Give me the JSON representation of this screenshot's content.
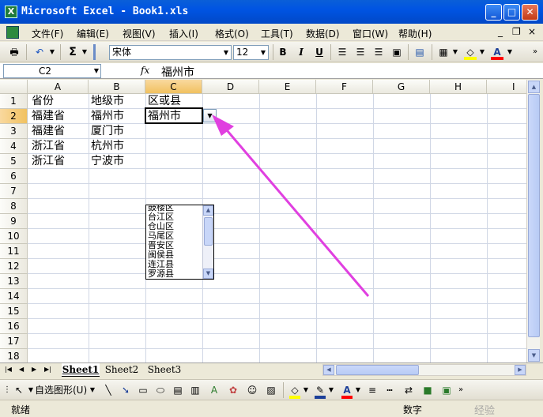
{
  "window": {
    "title": "Microsoft Excel - Book1.xls",
    "minimize": "_",
    "maximize": "□",
    "close": "✕"
  },
  "menu": {
    "items": [
      "文件(F)",
      "编辑(E)",
      "视图(V)",
      "插入(I)",
      "格式(O)",
      "工具(T)",
      "数据(D)",
      "窗口(W)",
      "帮助(H)"
    ],
    "doc_minimize": "_",
    "doc_restore": "❐",
    "doc_close": "×"
  },
  "toolbar": {
    "font_name": "宋体",
    "font_size": "12",
    "bold": "B",
    "italic": "I",
    "underline": "U",
    "sum": "Σ",
    "fill_color": "#ffff00",
    "font_color": "#ff0000"
  },
  "formula_bar": {
    "name_box": "C2",
    "fx": "fx",
    "value": "福州市"
  },
  "columns": [
    "A",
    "B",
    "C",
    "D",
    "E",
    "F",
    "G",
    "H",
    "I"
  ],
  "selected_column": "C",
  "rows": [
    "1",
    "2",
    "3",
    "4",
    "5",
    "6",
    "7",
    "8",
    "9",
    "10",
    "11",
    "12",
    "13",
    "14",
    "15",
    "16",
    "17",
    "18"
  ],
  "selected_row": "2",
  "cells": {
    "A1": "省份",
    "B1": "地级市",
    "C1": "区或县",
    "A2": "福建省",
    "B2": "福州市",
    "C2": "福州市",
    "A3": "福建省",
    "B3": "厦门市",
    "A4": "浙江省",
    "B4": "杭州市",
    "A5": "浙江省",
    "B5": "宁波市"
  },
  "dropdown": {
    "options": [
      "鼓楼区",
      "台江区",
      "仓山区",
      "马尾区",
      "晋安区",
      "闽侯县",
      "连江县",
      "罗源县"
    ]
  },
  "sheets": {
    "tabs": [
      "Sheet1",
      "Sheet2",
      "Sheet3"
    ],
    "active": "Sheet1"
  },
  "drawing_toolbar": {
    "autoshapes": "自选图形(U)"
  },
  "status": {
    "left": "就绪",
    "mode": "数字"
  },
  "annotation": {
    "arrow_color": "#e040e0"
  },
  "watermark": {
    "text": "经验"
  }
}
